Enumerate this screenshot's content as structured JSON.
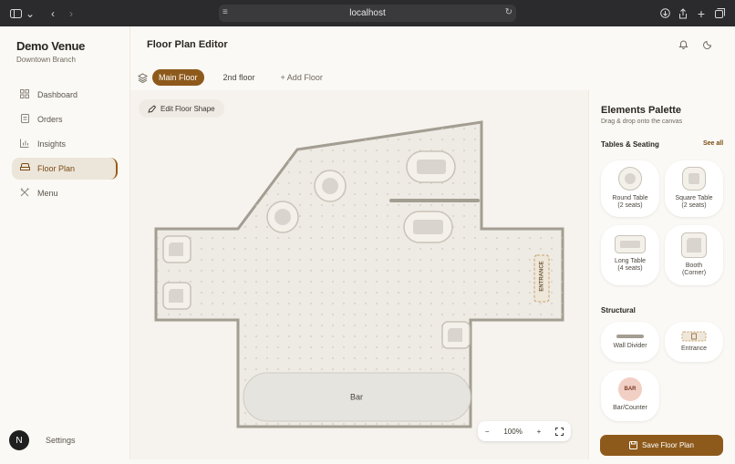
{
  "browser": {
    "url": "localhost"
  },
  "sidebar": {
    "brand": "Demo Venue",
    "branch": "Downtown Branch",
    "items": [
      {
        "label": "Dashboard",
        "icon": "grid-icon"
      },
      {
        "label": "Orders",
        "icon": "receipt-icon"
      },
      {
        "label": "Insights",
        "icon": "bar-chart-icon"
      },
      {
        "label": "Floor Plan",
        "icon": "sofa-icon"
      },
      {
        "label": "Menu",
        "icon": "utensils-icon"
      }
    ],
    "settings": "Settings",
    "avatar": "N"
  },
  "header": {
    "title": "Floor Plan Editor",
    "tabs": [
      "Main Floor",
      "2nd floor"
    ],
    "add_floor": "+ Add Floor"
  },
  "canvas": {
    "edit_shape": "Edit Floor Shape",
    "bar_label": "Bar",
    "entrance_label": "ENTRANCE",
    "zoom": "100%",
    "zoom_out": "−",
    "zoom_in": "+"
  },
  "palette": {
    "title": "Elements Palette",
    "subtitle": "Drag & drop onto the canvas",
    "tables_title": "Tables & Seating",
    "see_all": "See all",
    "tables": [
      {
        "line1": "Round Table",
        "line2": "(2 seats)"
      },
      {
        "line1": "Square Table",
        "line2": "(2 seats)"
      },
      {
        "line1": "Long Table",
        "line2": "(4 seats)"
      },
      {
        "line1": "Booth",
        "line2": "(Corner)"
      }
    ],
    "structural_title": "Structural",
    "structural": [
      {
        "line1": "Wall Divider"
      },
      {
        "line1": "Entrance"
      },
      {
        "line1": "Bar/Counter",
        "badge": "BAR"
      }
    ],
    "save": "Save Floor Plan"
  },
  "colors": {
    "accent": "#8e5a1c",
    "floor": "#eeeae4",
    "wall": "#a39d92"
  }
}
